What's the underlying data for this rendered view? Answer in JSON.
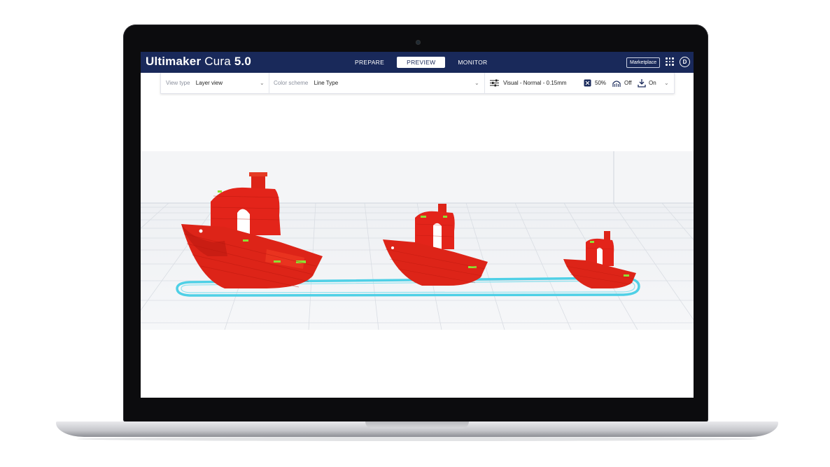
{
  "app": {
    "brand": "Ultimaker",
    "product": "Cura",
    "version": "5.0"
  },
  "stages": [
    {
      "label": "PREPARE",
      "active": false
    },
    {
      "label": "PREVIEW",
      "active": true
    },
    {
      "label": "MONITOR",
      "active": false
    }
  ],
  "header": {
    "marketplace_label": "Marketplace",
    "account_initial": "D"
  },
  "toolbar": {
    "view_type_label": "View type",
    "view_type_value": "Layer view",
    "color_scheme_label": "Color scheme",
    "color_scheme_value": "Line Type",
    "profile": "Visual - Normal - 0.15mm",
    "infill": "50%",
    "support": "Off",
    "adhesion": "On"
  },
  "icons": [
    "chevron-down-icon",
    "settings-sliders-icon",
    "infill-icon",
    "support-icon",
    "adhesion-icon",
    "apps-grid-icon",
    "account-icon"
  ],
  "colors": {
    "header_bg": "#19295a",
    "model_wall": "#e3241a",
    "skirt": "#4fd0e6",
    "top_skin": "#8ee033",
    "build_plate": "#f3f4f6"
  }
}
